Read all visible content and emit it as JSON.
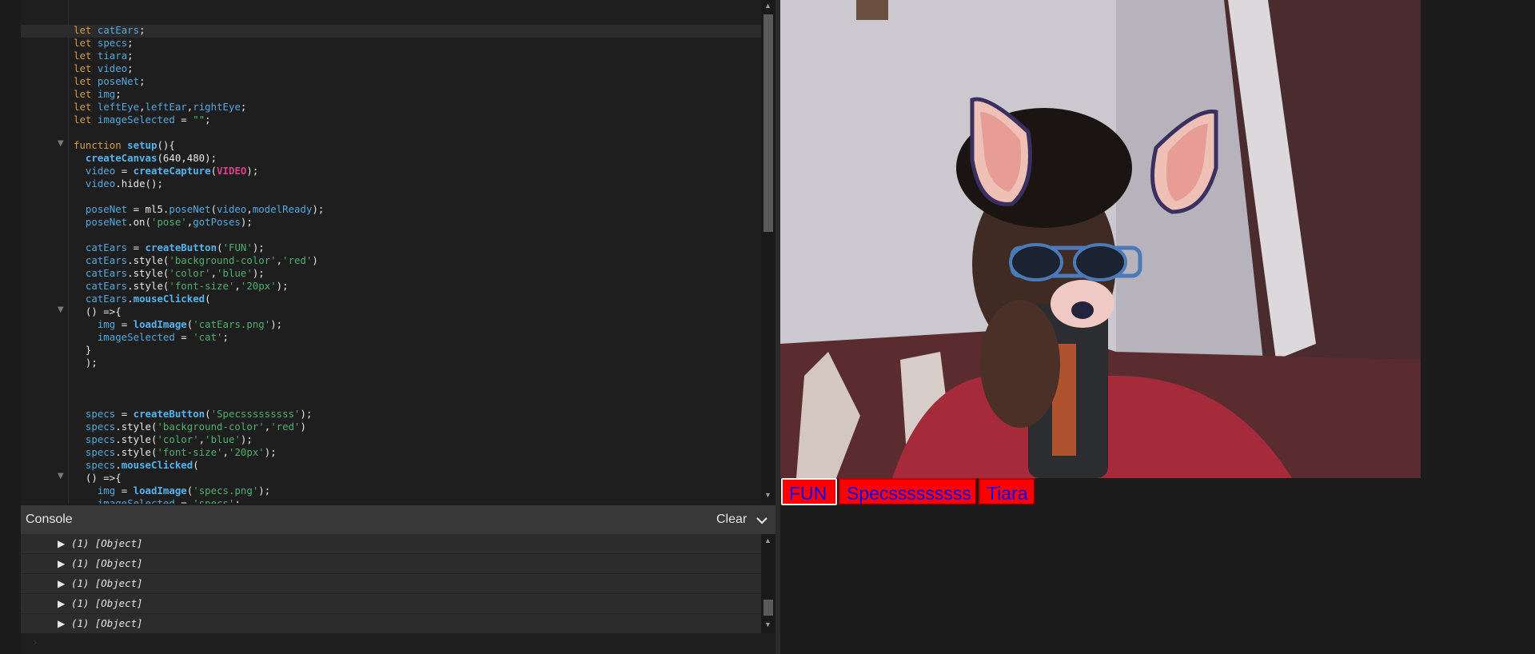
{
  "editor": {
    "lines": [
      "let catEars;",
      "let specs;",
      "let tiara;",
      "let video;",
      "let poseNet;",
      "let img;",
      "let leftEye,leftEar,rightEye;",
      "let imageSelected = \"\";",
      "",
      "function setup(){",
      "  createCanvas(640,480);",
      "  video = createCapture(VIDEO);",
      "  video.hide();",
      "",
      "  poseNet = ml5.poseNet(video,modelReady);",
      "  poseNet.on('pose',gotPoses);",
      "",
      "  catEars = createButton('FUN');",
      "  catEars.style('background-color','red')",
      "  catEars.style('color','blue');",
      "  catEars.style('font-size','20px');",
      "  catEars.mouseClicked(",
      "  () =>{",
      "    img = loadImage('catEars.png');",
      "    imageSelected = 'cat';",
      "  }",
      "  );",
      "",
      "",
      "",
      "  specs = createButton('Specsssssssss');",
      "  specs.style('background-color','red')",
      "  specs.style('color','blue');",
      "  specs.style('font-size','20px');",
      "  specs.mouseClicked(",
      "  () =>{",
      "    img = loadImage('specs.png');",
      "    imageSelected = 'specs';"
    ]
  },
  "console": {
    "title": "Console",
    "clear_label": "Clear",
    "entries": [
      "(1) [Object]",
      "(1) [Object]",
      "(1) [Object]",
      "(1) [Object]",
      "(1) [Object]"
    ]
  },
  "preview": {
    "buttons": [
      {
        "label": "FUN",
        "bg": "#ff0000",
        "color": "#0000ff"
      },
      {
        "label": "Specsssssssss",
        "bg": "#ff0000",
        "color": "#0000ff"
      },
      {
        "label": "Tiara",
        "bg": "#ff0000",
        "color": "#0000ff"
      }
    ]
  },
  "icons": {
    "fold": "fold-triangle-icon",
    "console_collapse": "chevron-down-icon",
    "expand": "expand-arrow-icon"
  }
}
